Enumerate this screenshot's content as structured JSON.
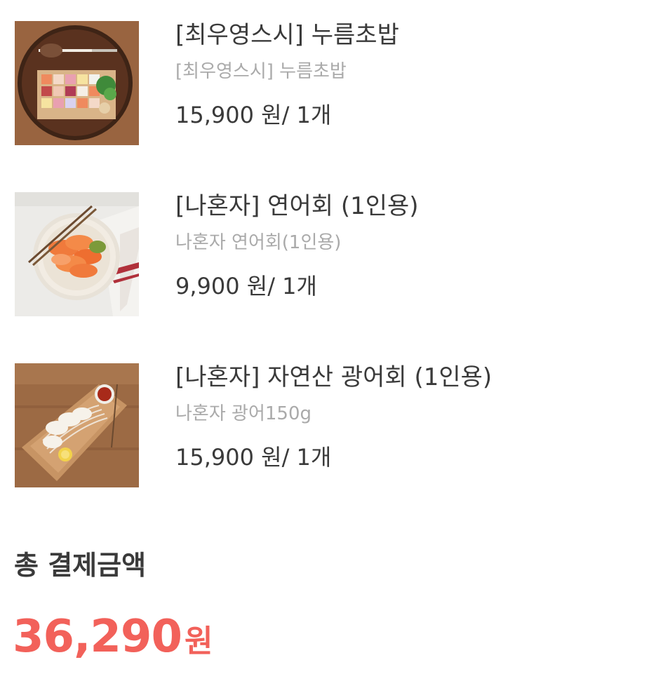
{
  "items": [
    {
      "title": "[최우영스시] 누름초밥",
      "option": "[최우영스시] 누름초밥",
      "price": "15,900 원/ 1개",
      "image": "pressed-sushi-tray-photo"
    },
    {
      "title": "[나혼자] 연어회 (1인용)",
      "option": "나혼자 연어회(1인용)",
      "price": "9,900 원/ 1개",
      "image": "salmon-sashimi-plate-photo"
    },
    {
      "title": "[나혼자] 자연산 광어회 (1인용)",
      "option": "나혼자 광어150g",
      "price": "15,900 원/ 1개",
      "image": "flatfish-sashimi-board-photo"
    }
  ],
  "total": {
    "label": "총 결제금액",
    "amount": "36,290",
    "unit": "원"
  },
  "colors": {
    "accent": "#f2615a",
    "text": "#3a3a3a",
    "muted": "#aaaaaa"
  }
}
